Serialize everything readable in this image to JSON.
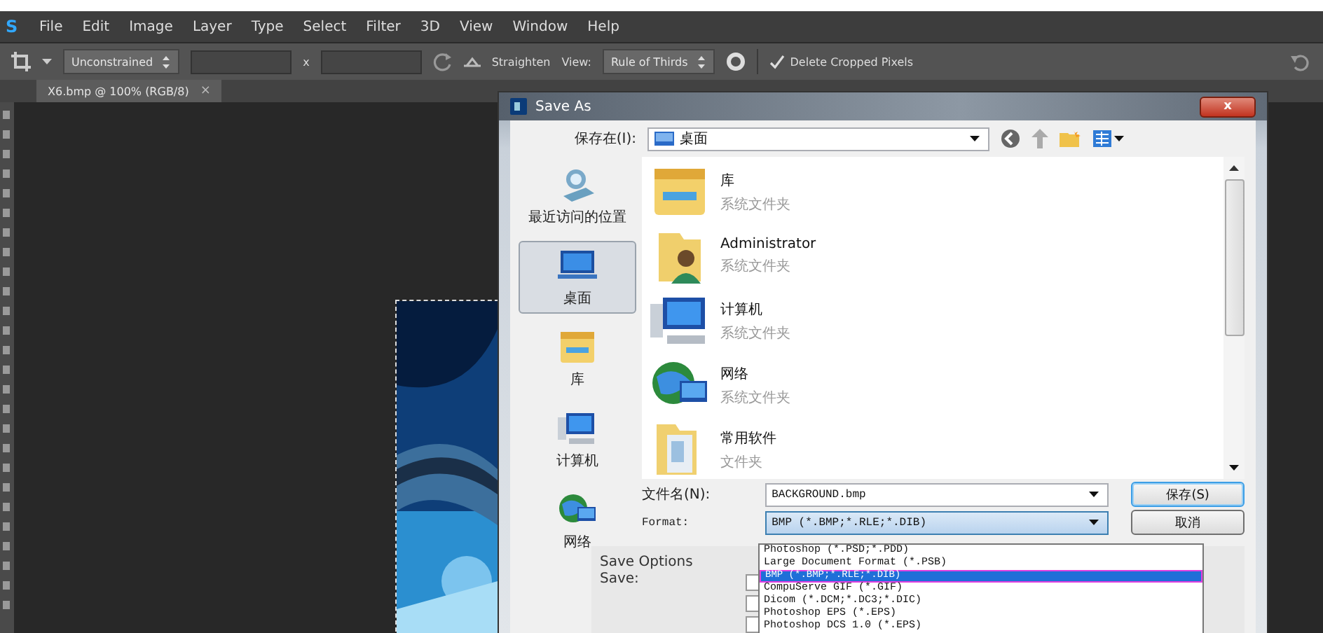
{
  "app": {
    "logo": "S"
  },
  "menu": [
    "File",
    "Edit",
    "Image",
    "Layer",
    "Type",
    "Select",
    "Filter",
    "3D",
    "View",
    "Window",
    "Help"
  ],
  "options_bar": {
    "ratio": "Unconstrained",
    "times": "x",
    "straighten": "Straighten",
    "view_label": "View:",
    "view": "Rule of Thirds",
    "delete_cropped": {
      "label": "Delete Cropped Pixels",
      "checked": true
    }
  },
  "document_tab": {
    "title": "X6.bmp @ 100% (RGB/8)",
    "close": "×"
  },
  "dialog": {
    "title": "Save As",
    "close": "x",
    "save_in_label": "保存在(I):",
    "save_in_value": "桌面",
    "places": [
      {
        "label": "最近访问的位置",
        "kind": "recent",
        "selected": false
      },
      {
        "label": "桌面",
        "kind": "desktop",
        "selected": true
      },
      {
        "label": "库",
        "kind": "library",
        "selected": false
      },
      {
        "label": "计算机",
        "kind": "computer",
        "selected": false
      },
      {
        "label": "网络",
        "kind": "network",
        "selected": false
      }
    ],
    "files": [
      {
        "name": "库",
        "type": "系统文件夹",
        "kind": "library"
      },
      {
        "name": "Administrator",
        "type": "系统文件夹",
        "kind": "user"
      },
      {
        "name": "计算机",
        "type": "系统文件夹",
        "kind": "computer"
      },
      {
        "name": "网络",
        "type": "系统文件夹",
        "kind": "network"
      },
      {
        "name": "常用软件",
        "type": "文件夹",
        "kind": "folder"
      }
    ],
    "filename_label": "文件名(N):",
    "filename": "BACKGROUND.bmp",
    "format_label": "Format:",
    "format": "BMP (*.BMP;*.RLE;*.DIB)",
    "save_button": "保存(S)",
    "cancel_button": "取消",
    "format_options": [
      {
        "label": "Photoshop (*.PSD;*.PDD)",
        "selected": false,
        "outlined": false
      },
      {
        "label": "Large Document Format (*.PSB)",
        "selected": false,
        "outlined": false
      },
      {
        "label": "BMP (*.BMP;*.RLE;*.DIB)",
        "selected": true,
        "outlined": true
      },
      {
        "label": "CompuServe GIF (*.GIF)",
        "selected": false,
        "outlined": false
      },
      {
        "label": "Dicom (*.DCM;*.DC3;*.DIC)",
        "selected": false,
        "outlined": false
      },
      {
        "label": "Photoshop EPS (*.EPS)",
        "selected": false,
        "outlined": false
      },
      {
        "label": "Photoshop DCS 1.0 (*.EPS)",
        "selected": false,
        "outlined": false
      }
    ],
    "save_options": {
      "title": "Save Options",
      "save_label": "Save:",
      "checkboxes": [
        {
          "checked": false
        },
        {
          "checked": false
        },
        {
          "checked": false
        }
      ]
    }
  }
}
